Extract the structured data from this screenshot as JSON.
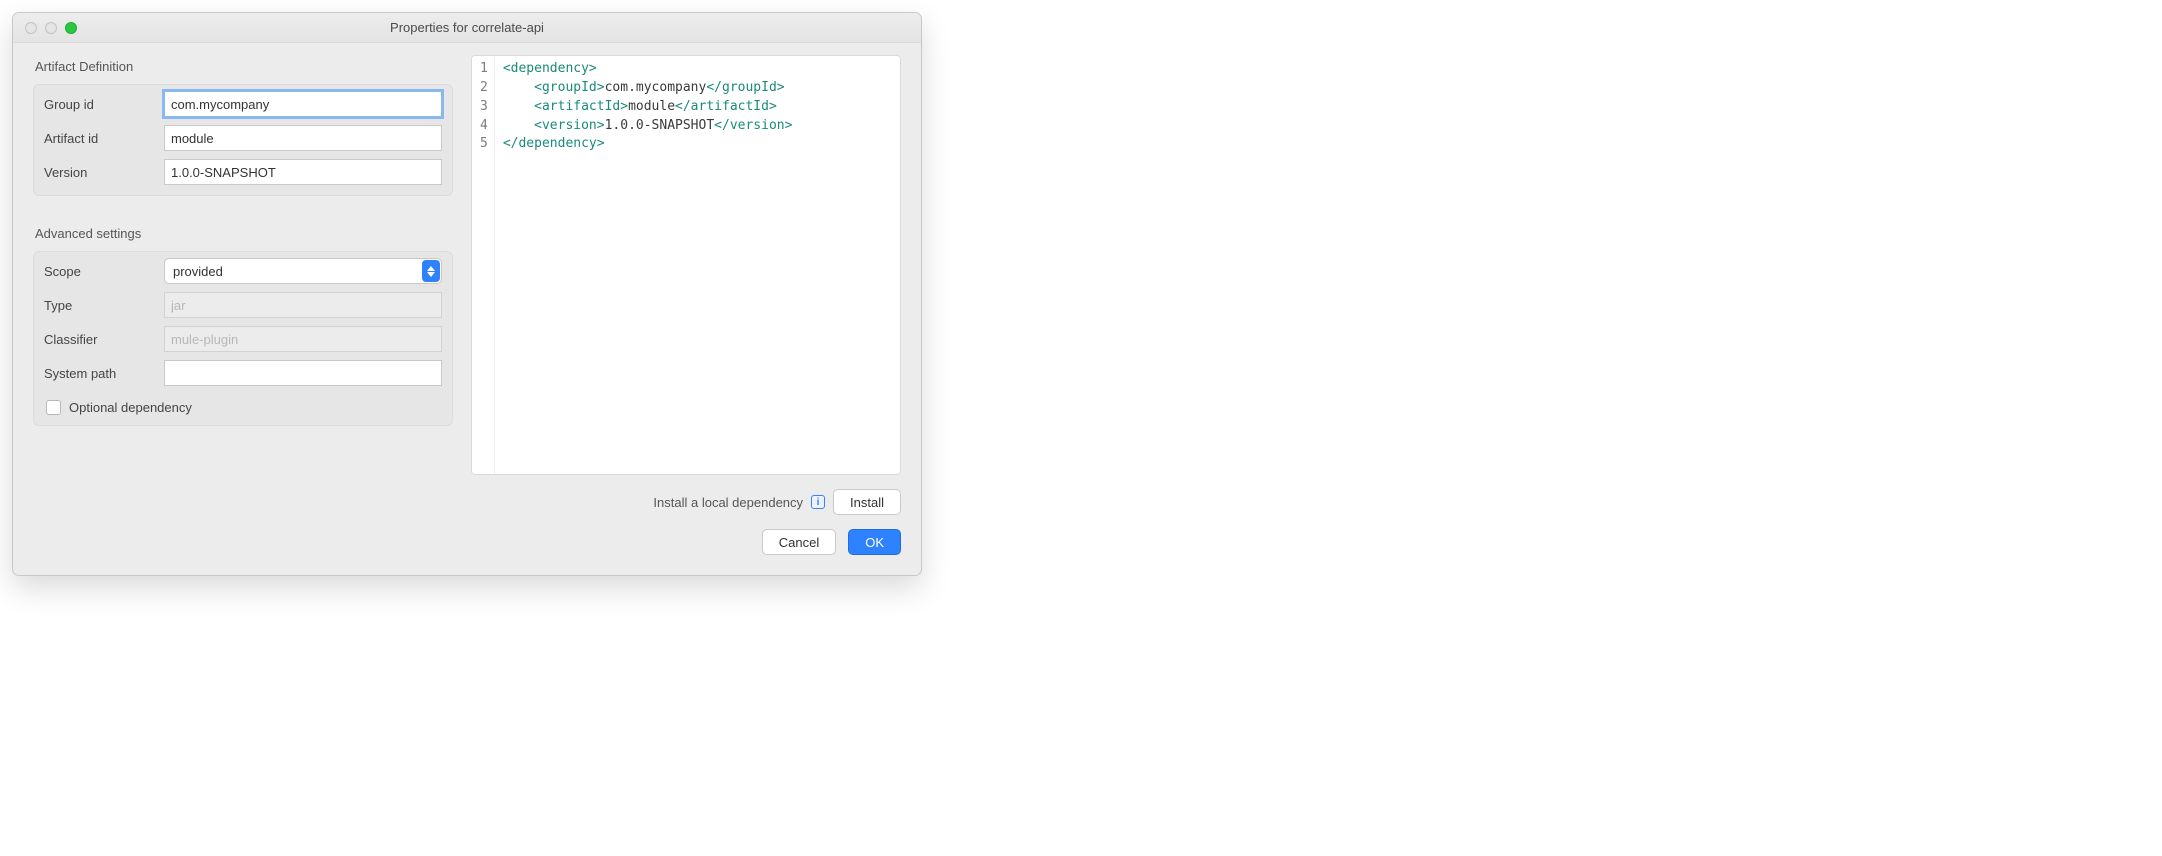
{
  "window": {
    "title": "Properties for correlate-api"
  },
  "artifact": {
    "heading": "Artifact Definition",
    "groupId": {
      "label": "Group id",
      "value": "com.mycompany"
    },
    "artifactId": {
      "label": "Artifact id",
      "value": "module"
    },
    "version": {
      "label": "Version",
      "value": "1.0.0-SNAPSHOT"
    }
  },
  "advanced": {
    "heading": "Advanced settings",
    "scope": {
      "label": "Scope",
      "value": "provided"
    },
    "type": {
      "label": "Type",
      "placeholder": "jar",
      "value": ""
    },
    "classifier": {
      "label": "Classifier",
      "placeholder": "mule-plugin",
      "value": ""
    },
    "systemPath": {
      "label": "System path",
      "value": ""
    },
    "optional": {
      "label": "Optional dependency",
      "checked": false
    }
  },
  "xml": {
    "lines": [
      {
        "n": "1",
        "indent": "",
        "open": "<dependency>",
        "text": "",
        "close": ""
      },
      {
        "n": "2",
        "indent": "    ",
        "open": "<groupId>",
        "text": "com.mycompany",
        "close": "</groupId>"
      },
      {
        "n": "3",
        "indent": "    ",
        "open": "<artifactId>",
        "text": "module",
        "close": "</artifactId>"
      },
      {
        "n": "4",
        "indent": "    ",
        "open": "<version>",
        "text": "1.0.0-SNAPSHOT",
        "close": "</version>"
      },
      {
        "n": "5",
        "indent": "",
        "open": "</dependency>",
        "text": "",
        "close": ""
      }
    ]
  },
  "footer": {
    "installText": "Install a local dependency",
    "install": "Install",
    "cancel": "Cancel",
    "ok": "OK"
  }
}
